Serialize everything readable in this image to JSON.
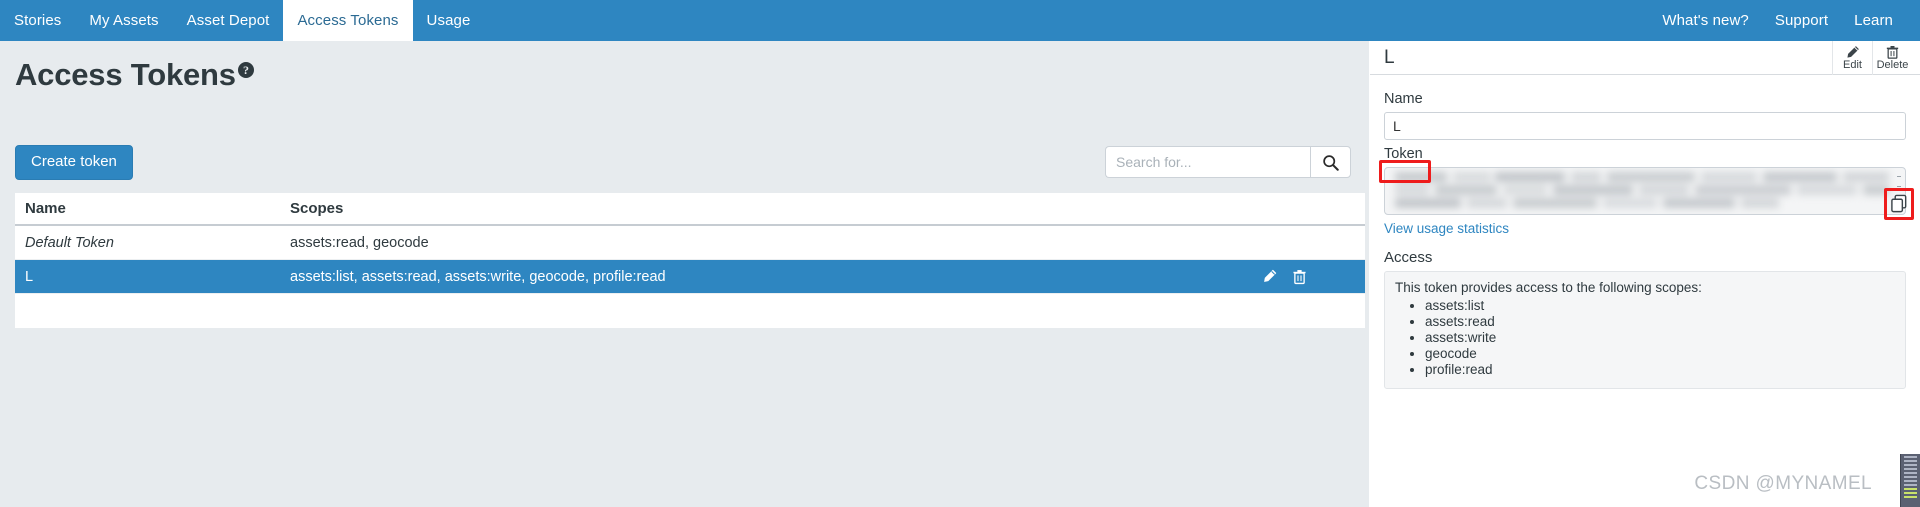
{
  "navbar": {
    "left_items": [
      {
        "label": "Stories",
        "active": false
      },
      {
        "label": "My Assets",
        "active": false
      },
      {
        "label": "Asset Depot",
        "active": false
      },
      {
        "label": "Access Tokens",
        "active": true
      },
      {
        "label": "Usage",
        "active": false
      }
    ],
    "right_items": [
      {
        "label": "What's new?"
      },
      {
        "label": "Support"
      },
      {
        "label": "Learn"
      }
    ],
    "background_color": "#2e86c1",
    "active_tab_color": "#ffffff"
  },
  "main": {
    "page_title": "Access Tokens",
    "help_icon": "question-mark-icon",
    "create_button": "Create token",
    "search": {
      "placeholder": "Search for...",
      "value": "",
      "icon": "search-icon"
    },
    "table": {
      "columns": [
        "Name",
        "Scopes"
      ],
      "rows": [
        {
          "name": "Default Token",
          "scopes": "assets:read, geocode",
          "selected": false,
          "italic": true
        },
        {
          "name": "L",
          "scopes": "assets:list, assets:read, assets:write, geocode, profile:read",
          "selected": true,
          "italic": false,
          "actions": [
            "edit-icon",
            "delete-icon"
          ]
        }
      ]
    }
  },
  "detail_panel": {
    "title": "L",
    "actions": [
      {
        "label": "Edit",
        "icon": "pencil-icon"
      },
      {
        "label": "Delete",
        "icon": "trash-icon"
      }
    ],
    "name_label": "Name",
    "name_value": "L",
    "token_label": "Token",
    "token_value": "",
    "token_masked": true,
    "copy_icon": "copy-icon",
    "usage_link": "View usage statistics",
    "access_label": "Access",
    "access_intro": "This token provides access to the following scopes:",
    "scopes": [
      "assets:list",
      "assets:read",
      "assets:write",
      "geocode",
      "profile:read"
    ]
  },
  "annotations": {
    "color": "#ee1c1c",
    "boxes": [
      "token-label-highlight",
      "copy-button-highlight"
    ]
  },
  "watermark": "CSDN @MYNAMEL"
}
